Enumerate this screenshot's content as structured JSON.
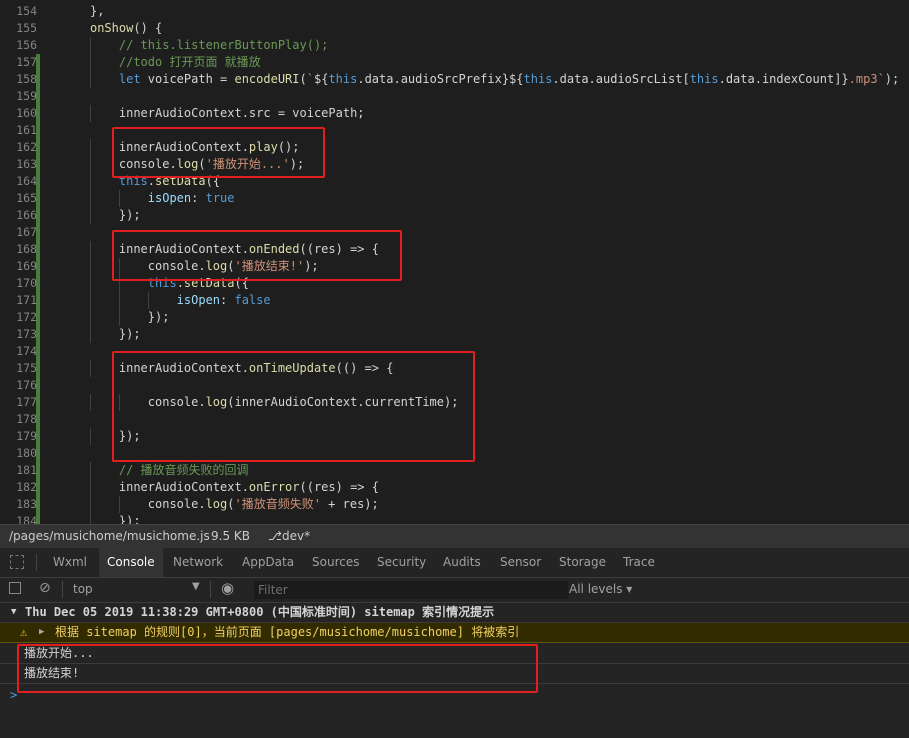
{
  "editor": {
    "lines": [
      {
        "n": "154",
        "t": "    },"
      },
      {
        "n": "155",
        "t": "    onShow() {"
      },
      {
        "n": "156",
        "t": "        // this.listenerButtonPlay();"
      },
      {
        "n": "157",
        "t": "        //todo 打开页面 就播放"
      },
      {
        "n": "158",
        "t": "        let voicePath = encodeURI(`${this.data.audioSrcPrefix}${this.data.audioSrcList[this.data.indexCount]}.mp3`);"
      },
      {
        "n": "159",
        "t": ""
      },
      {
        "n": "160",
        "t": "        innerAudioContext.src = voicePath;"
      },
      {
        "n": "161",
        "t": ""
      },
      {
        "n": "162",
        "t": "        innerAudioContext.play();"
      },
      {
        "n": "163",
        "t": "        console.log('播放开始...');"
      },
      {
        "n": "164",
        "t": "        this.setData({"
      },
      {
        "n": "165",
        "t": "            isOpen: true"
      },
      {
        "n": "166",
        "t": "        });"
      },
      {
        "n": "167",
        "t": ""
      },
      {
        "n": "168",
        "t": "        innerAudioContext.onEnded((res) => {"
      },
      {
        "n": "169",
        "t": "            console.log('播放结束!');"
      },
      {
        "n": "170",
        "t": "            this.setData({"
      },
      {
        "n": "171",
        "t": "                isOpen: false"
      },
      {
        "n": "172",
        "t": "            });"
      },
      {
        "n": "173",
        "t": "        });"
      },
      {
        "n": "174",
        "t": ""
      },
      {
        "n": "175",
        "t": "        innerAudioContext.onTimeUpdate(() => {"
      },
      {
        "n": "176",
        "t": ""
      },
      {
        "n": "177",
        "t": "            console.log(innerAudioContext.currentTime);"
      },
      {
        "n": "178",
        "t": ""
      },
      {
        "n": "179",
        "t": "        });"
      },
      {
        "n": "180",
        "t": ""
      },
      {
        "n": "181",
        "t": "        // 播放音频失败的回调"
      },
      {
        "n": "182",
        "t": "        innerAudioContext.onError((res) => {"
      },
      {
        "n": "183",
        "t": "            console.log('播放音频失败' + res);"
      },
      {
        "n": "184",
        "t": "        });"
      }
    ]
  },
  "filebar": {
    "path": "/pages/musichome/musichome.js",
    "size": "9.5 KB",
    "branch": "dev*"
  },
  "devtools": {
    "tabs": [
      "Wxml",
      "Console",
      "Network",
      "AppData",
      "Sources",
      "Security",
      "Audits",
      "Sensor",
      "Storage",
      "Trace"
    ],
    "active_tab": "Console",
    "context": "top",
    "filter_placeholder": "Filter",
    "levels": "All levels ▾"
  },
  "console": {
    "group_header": "Thu Dec 05 2019 11:38:29 GMT+0800 (中国标准时间) sitemap 索引情况提示",
    "warning": "根据 sitemap 的规则[0]，当前页面 [pages/musichome/musichome] 将被索引",
    "logs": [
      "播放开始...",
      "播放结束!"
    ],
    "prompt": ">"
  },
  "colors": {
    "highlight_box": "#e02020",
    "modified_bar": "#487e3a",
    "keyword": "#569cd6",
    "string": "#ce9178",
    "comment": "#6a9955"
  }
}
